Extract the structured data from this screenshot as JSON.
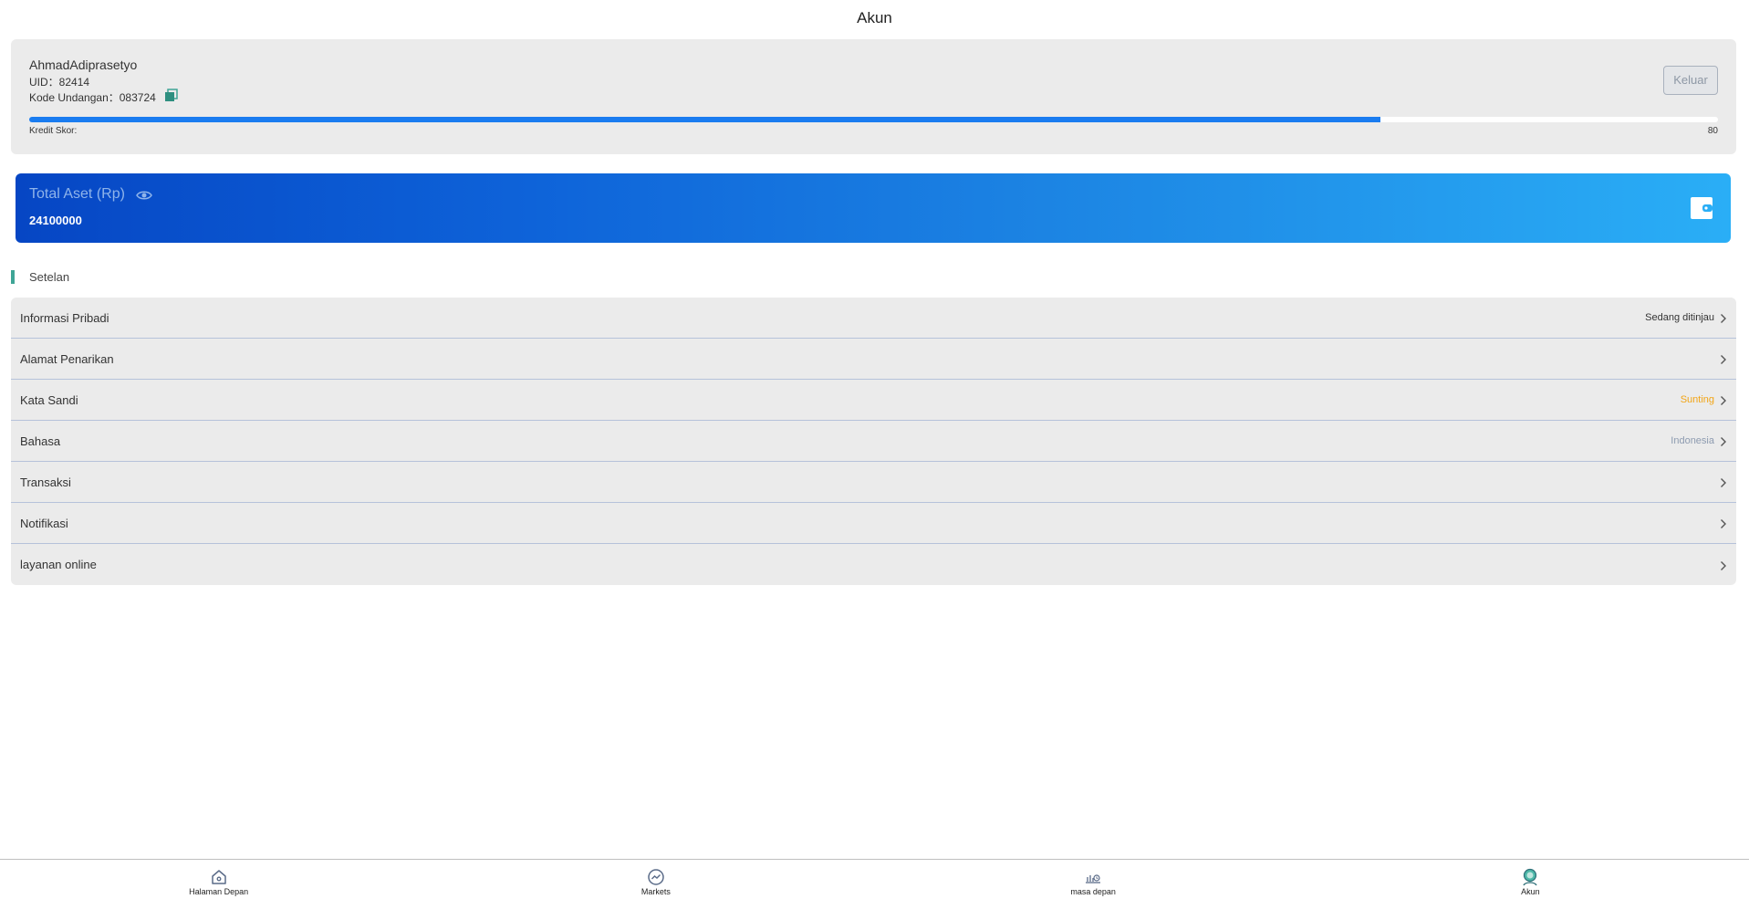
{
  "page": {
    "title": "Akun"
  },
  "profile": {
    "username": "AhmadAdiprasetyo",
    "uid_label": "UID：",
    "uid": "82414",
    "invite_label": "Kode Undangan：",
    "invite_code": "083724",
    "logout_label": "Keluar",
    "credit_label": "Kredit Skor:",
    "credit_score": "80",
    "credit_progress_percent": 80
  },
  "assets": {
    "title": "Total Aset (Rp)",
    "value": "24100000"
  },
  "settings": {
    "title": "Setelan",
    "items": [
      {
        "label": "Informasi Pribadi",
        "status": "Sedang ditinjau",
        "status_color": "#333333"
      },
      {
        "label": "Alamat Penarikan",
        "status": "",
        "status_color": "#333333"
      },
      {
        "label": "Kata Sandi",
        "status": "Sunting",
        "status_color": "#f2a516"
      },
      {
        "label": "Bahasa",
        "status": "Indonesia",
        "status_color": "#8d9bb0"
      },
      {
        "label": "Transaksi",
        "status": "",
        "status_color": "#333333"
      },
      {
        "label": "Notifikasi",
        "status": "",
        "status_color": "#333333"
      },
      {
        "label": "layanan online",
        "status": "",
        "status_color": "#333333"
      }
    ]
  },
  "nav": {
    "items": [
      {
        "label": "Halaman Depan",
        "icon": "home-icon"
      },
      {
        "label": "Markets",
        "icon": "markets-icon"
      },
      {
        "label": "masa depan",
        "icon": "futures-icon"
      },
      {
        "label": "Akun",
        "icon": "account-icon"
      }
    ]
  },
  "colors": {
    "accent_blue": "#1a7cf0",
    "section_bar": "#3fa596",
    "banner_start": "#0646c4",
    "banner_end": "#2aaef6"
  }
}
